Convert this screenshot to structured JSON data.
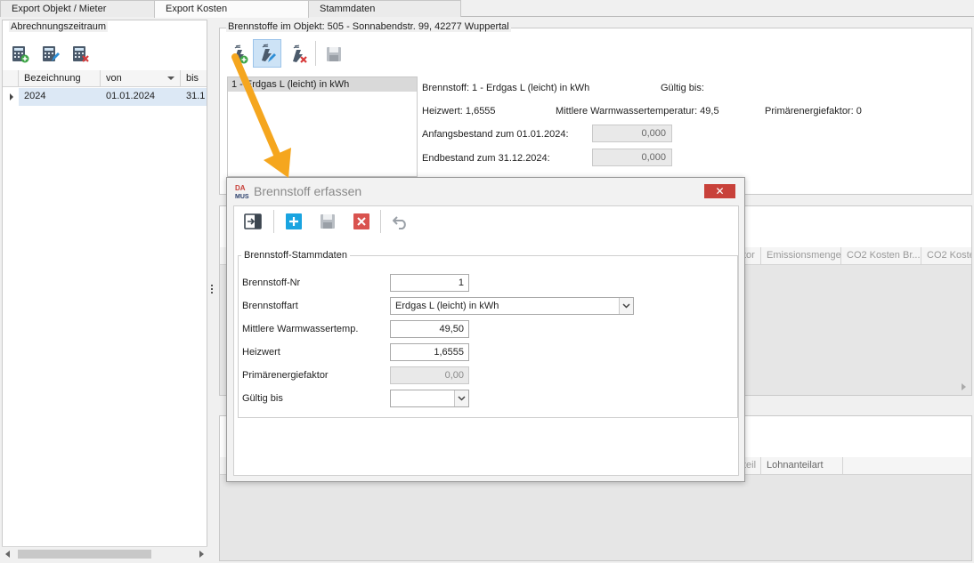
{
  "tabs": [
    {
      "label": "Export Objekt / Mieter"
    },
    {
      "label": "Export Kosten"
    },
    {
      "label": "Stammdaten"
    }
  ],
  "left": {
    "group_title": "Abrechnungszeitraum",
    "columns": [
      "Bezeichnung",
      "von",
      "bis"
    ],
    "rows": [
      {
        "bezeichnung": "2024",
        "von": "01.01.2024",
        "bis": "31.1"
      }
    ]
  },
  "fuel": {
    "group_title": "Brennstoffe im Objekt: 505 - Sonnabendstr. 99, 42277 Wuppertal",
    "list": [
      {
        "label": "1 - Erdgas L (leicht) in kWh"
      }
    ],
    "brennstoff_label": "Brennstoff: 1 - Erdgas L (leicht) in kWh",
    "gueltig_label": "Gültig bis:",
    "heizwert_label": "Heizwert: 1,6555",
    "warmwasser_label": "Mittlere Warmwassertemperatur: 49,5",
    "primaer_label": "Primärenergiefaktor: 0",
    "anfang_label": "Anfangsbestand zum 01.01.2024:",
    "anfang_value": "0,000",
    "end_label": "Endbestand zum 31.12.2024:",
    "end_value": "0,000"
  },
  "grid2": {
    "columns": [
      "tor",
      "Emissionsmenge",
      "CO2 Kosten Br...",
      "CO2 Koste"
    ]
  },
  "grid3": {
    "columns": [
      "teil",
      "Lohnanteilart"
    ]
  },
  "dialog": {
    "logo_text": "DA MUS",
    "title": "Brennstoff erfassen",
    "close": "✕",
    "section_title": "Brennstoff-Stammdaten",
    "fields": {
      "nr_label": "Brennstoff-Nr",
      "nr_value": "1",
      "art_label": "Brennstoffart",
      "art_value": "Erdgas L (leicht) in kWh",
      "ww_label": "Mittlere Warmwassertemp.",
      "ww_value": "49,50",
      "heizwert_label": "Heizwert",
      "heizwert_value": "1,6555",
      "primaer_label": "Primärenergiefaktor",
      "primaer_value": "0,00",
      "gueltig_label": "Gültig bis",
      "gueltig_value": ""
    }
  },
  "colors": {
    "accent_arrow": "#f5a61e",
    "close_red": "#c8413a",
    "selected_row": "#dce8f5",
    "add_blue": "#1aa4e0",
    "delete_red": "#d9534f"
  }
}
